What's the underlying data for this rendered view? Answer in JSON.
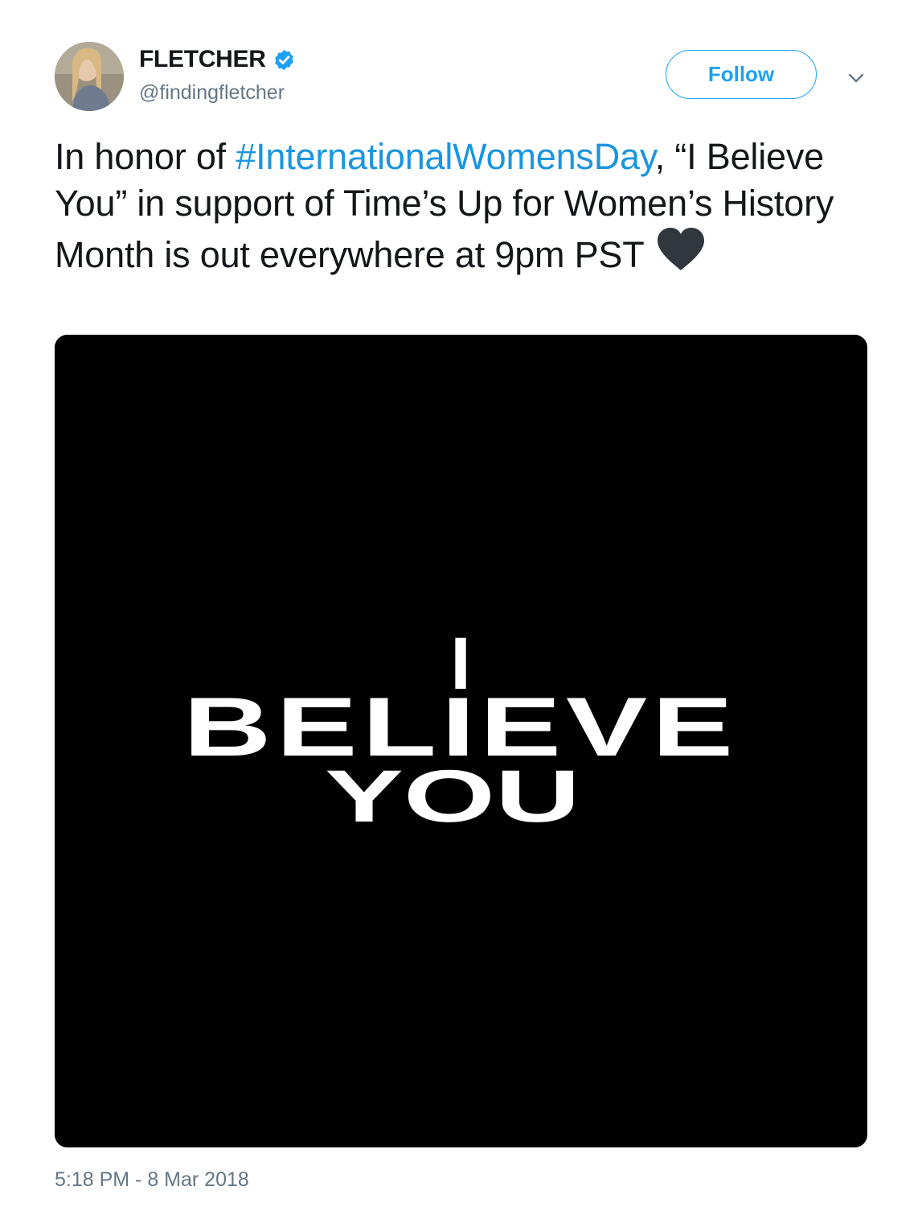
{
  "author": {
    "name": "FLETCHER",
    "handle": "@findingfletcher",
    "verified": true,
    "verified_icon": "verified-badge-icon",
    "avatar_icon": "user-avatar"
  },
  "follow_label": "Follow",
  "menu_icon": "chevron-down-icon",
  "tweet": {
    "text_before": "In honor of ",
    "hashtag": "#InternationalWomensDay",
    "text_after": ", “I Believe You” in support of Time’s Up for Women’s History Month is out everywhere at 9pm PST",
    "emoji_icon": "black-heart-icon"
  },
  "media": {
    "line1": "I",
    "line2": "BELIEVE",
    "line3": "YOU"
  },
  "timestamp": "5:18 PM - 8 Mar 2018",
  "colors": {
    "accent": "#1da1f2",
    "hashtag": "#1b95e0",
    "text": "#14171a",
    "muted": "#657786",
    "media_background": "#000000"
  }
}
